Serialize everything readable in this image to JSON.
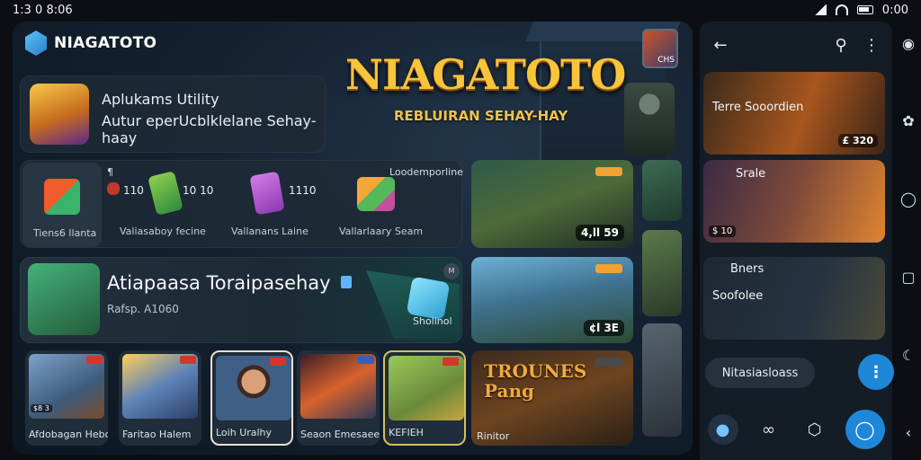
{
  "status_bar": {
    "time": "1:3 0 8:06",
    "clock": "0:00"
  },
  "header": {
    "app_name": "NIAGATOTO"
  },
  "hero": {
    "title": "NIAGATOTO",
    "subtitle": "REBLUIRAN SEHAY-HAY",
    "thumb_label": "CHS"
  },
  "utility_card": {
    "title": "Aplukams Utility",
    "description": "Autur eperUcblklelane Sehay-haay"
  },
  "tools": {
    "header_left": "¶",
    "header_right": "Loodemporline",
    "items": [
      {
        "label": "Tiens6 llanta",
        "count": ""
      },
      {
        "label": "Valiasaboy fecine",
        "count": "10 10",
        "badge": "110"
      },
      {
        "label": "Vallanans Laine",
        "count": "1110"
      },
      {
        "label": "Vallarlaary Seam",
        "count": ""
      }
    ]
  },
  "banner": {
    "title": "Atiapaasa Toraipasehay",
    "subtitle": "Rafsp. A1060",
    "button": "Sholinol"
  },
  "thumbnails": [
    {
      "label": "Afdobagan Hebonito",
      "pill": "$8 3"
    },
    {
      "label": "Faritao Halem",
      "pill": ""
    },
    {
      "label": "Loih Uralhy",
      "pill": ""
    },
    {
      "label": "Seaon Emesaeen",
      "pill": ""
    },
    {
      "label": "KEFIEH",
      "pill": ""
    }
  ],
  "game_cards": [
    {
      "price": "4,ll 59"
    },
    {
      "price": "¢l 3E"
    },
    {
      "title": "TROUNES Pang",
      "footer": "Rinitor"
    }
  ],
  "right_panel": {
    "cards": [
      {
        "title": "Terre Sooordien",
        "price": "£ 320"
      },
      {
        "title": "Srale",
        "badge": "$ 10"
      },
      {
        "title": "Bners",
        "subtitle": "Soofolee"
      }
    ],
    "search_chip": "Nitasiasloass"
  },
  "colors": {
    "accent": "#1f87d8",
    "brand_gold": "#f7c43b",
    "panel": "#141c25"
  }
}
